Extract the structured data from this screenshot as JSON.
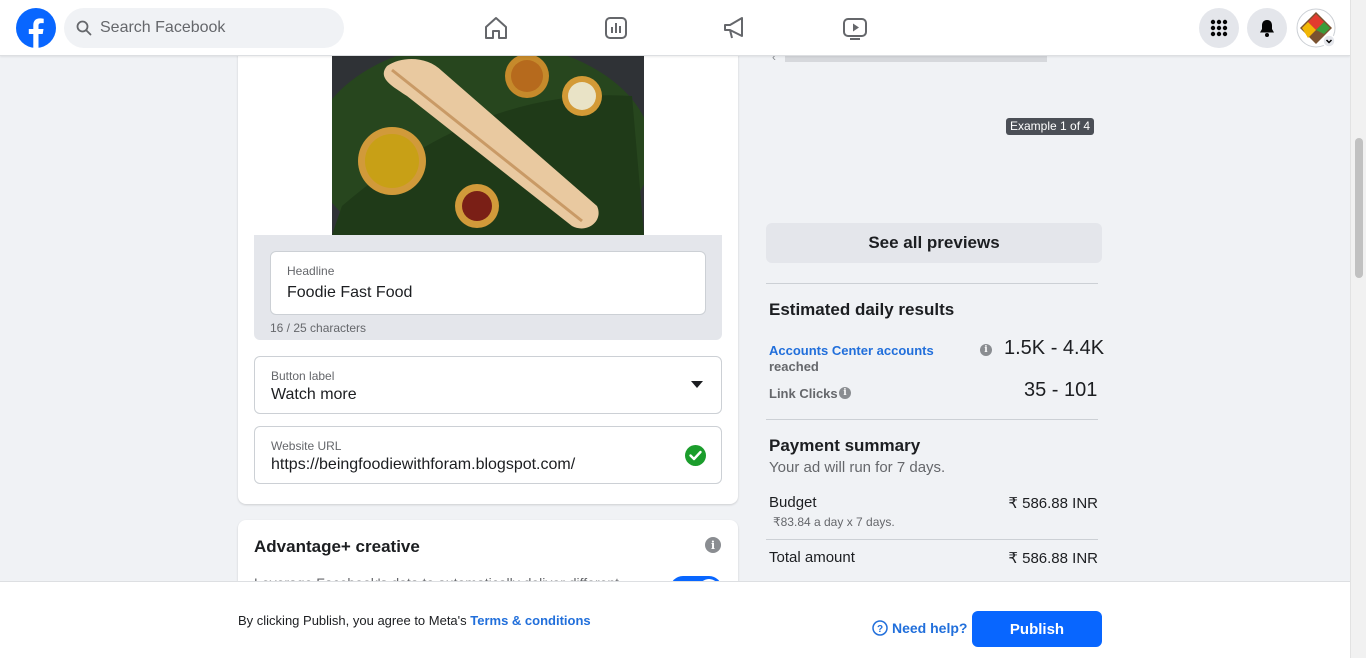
{
  "header": {
    "search_placeholder": "Search Facebook",
    "nav_icons": [
      "home-icon",
      "dashboard-icon",
      "megaphone-icon",
      "video-icon"
    ],
    "right_icons": [
      "menu-grid-icon",
      "bell-icon"
    ]
  },
  "ad_form": {
    "headline_label": "Headline",
    "headline_value": "Foodie Fast Food",
    "headline_counter": "16 / 25 characters",
    "button_label_label": "Button label",
    "button_label_value": "Watch more",
    "website_label": "Website URL",
    "website_value": "https://beingfoodiewithforam.blogspot.com/"
  },
  "advantage": {
    "title": "Advantage+ creative",
    "description": "Leverage Facebook's data to automatically deliver different",
    "enabled": true
  },
  "preview": {
    "example_badge": "Example 1 of 4",
    "see_all_label": "See all previews"
  },
  "estimated": {
    "title": "Estimated daily results",
    "accounts_link": "Accounts Center accounts",
    "accounts_suffix": "reached",
    "accounts_value": "1.5K - 4.4K",
    "clicks_label": "Link Clicks",
    "clicks_value": "35 - 101"
  },
  "payment": {
    "title": "Payment summary",
    "subtitle": "Your ad will run for 7 days.",
    "budget_label": "Budget",
    "budget_value": "₹ 586.88 INR",
    "budget_detail": "₹83.84 a day x 7 days.",
    "total_label": "Total amount",
    "total_value": "₹ 586.88 INR"
  },
  "footer": {
    "agree_prefix": "By clicking Publish, you agree to Meta's ",
    "terms_link": "Terms & conditions",
    "need_help": "Need help?",
    "publish_label": "Publish"
  },
  "colors": {
    "brand_blue": "#0866ff",
    "link_blue": "#216fdb",
    "page_bg": "#f0f2f5",
    "success_green": "#1b9d2c"
  }
}
